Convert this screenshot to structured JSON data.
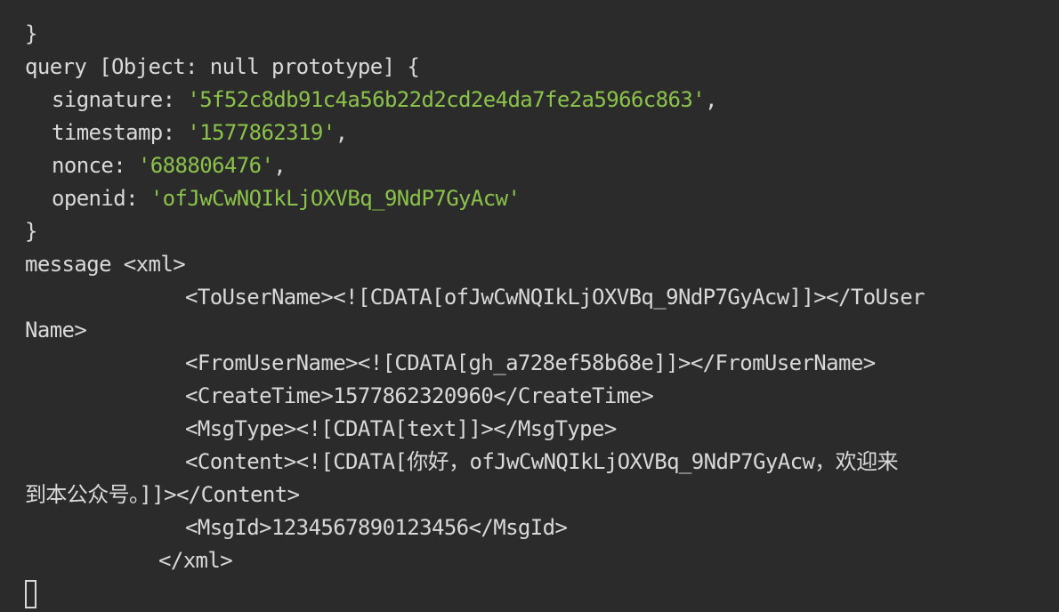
{
  "theme": {
    "background": "#2b2b2b",
    "text": "#d9d9d9",
    "string": "#8bc34a"
  },
  "terminal": {
    "brace_close_1": "}",
    "query_header": "query [Object: null prototype] {",
    "query": [
      {
        "key": "signature",
        "value": "'5f52c8db91c4a56b22d2cd2e4da7fe2a5966c863'",
        "suffix": ","
      },
      {
        "key": "timestamp",
        "value": "'1577862319'",
        "suffix": ","
      },
      {
        "key": "nonce",
        "value": "'688806476'",
        "suffix": ","
      },
      {
        "key": "openid",
        "value": "'ofJwCwNQIkLjOXVBq_9NdP7GyAcw'",
        "suffix": ""
      }
    ],
    "brace_close_2": "}",
    "message_header": "message <xml>",
    "xml_to_user_part1": "<ToUserName><![CDATA[ofJwCwNQIkLjOXVBq_9NdP7GyAcw]]></ToUser",
    "xml_to_user_part2": "Name>",
    "xml_from_user": "<FromUserName><![CDATA[gh_a728ef58b68e]]></FromUserName>",
    "xml_create_time": "<CreateTime>1577862320960</CreateTime>",
    "xml_msg_type": "<MsgType><![CDATA[text]]></MsgType>",
    "xml_content_part1": "<Content><![CDATA[你好，ofJwCwNQIkLjOXVBq_9NdP7GyAcw，欢迎来",
    "xml_content_part2": "到本公众号。]]></Content>",
    "xml_msg_id": "<MsgId>1234567890123456</MsgId>",
    "xml_close": "</xml>"
  }
}
